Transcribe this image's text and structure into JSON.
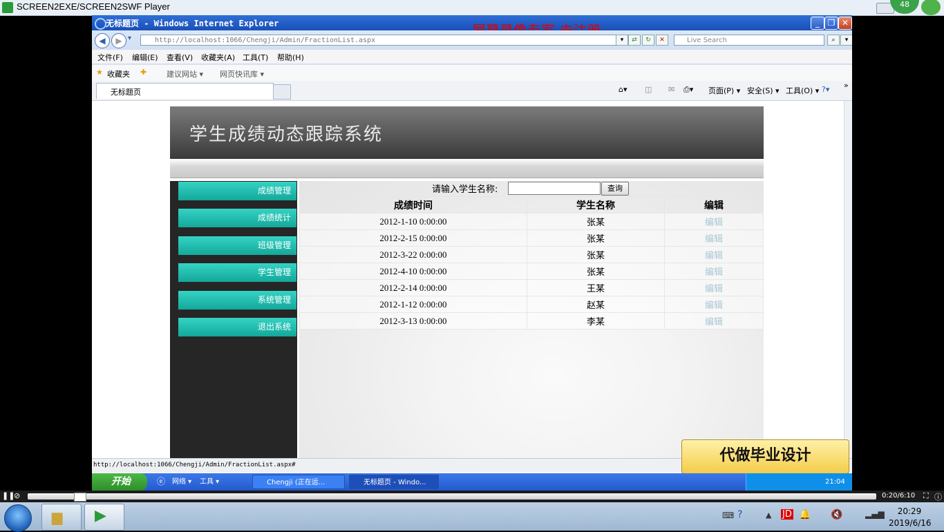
{
  "player": {
    "title": "SCREEN2EXE/SCREEN2SWF Player",
    "badge": "48",
    "timecode": "0:20/6:10"
  },
  "ie": {
    "window_title": "无标题页 - Windows Internet Explorer",
    "watermark": "屏幕录像专家 未注册",
    "address": "http://localhost:1066/Chengji/Admin/FractionList.aspx",
    "search_placeholder": "Live Search",
    "menu": [
      "文件(F)",
      "编辑(E)",
      "查看(V)",
      "收藏夹(A)",
      "工具(T)",
      "帮助(H)"
    ],
    "favorites": {
      "label": "收藏夹",
      "suggested": "建议网站 ▾",
      "slices": "网页快讯库 ▾"
    },
    "tab_title": "无标题页",
    "cmdbar": {
      "page": "页面(P) ▾",
      "safety": "安全(S) ▾",
      "tools": "工具(O) ▾"
    },
    "status_url": "http://localhost:1066/Chengji/Admin/FractionList.aspx#"
  },
  "app": {
    "banner_title": "学生成绩动态跟踪系统",
    "sidebar": [
      {
        "label": "成绩管理"
      },
      {
        "label": "成绩统计"
      },
      {
        "label": "班级管理"
      },
      {
        "label": "学生管理"
      },
      {
        "label": "系统管理"
      },
      {
        "label": "退出系统"
      }
    ],
    "search_label": "请输入学生名称:",
    "search_value": "",
    "search_button": "查询",
    "columns": [
      "成绩时间",
      "学生名称",
      "编辑"
    ],
    "rows": [
      {
        "time": "2012-1-10 0:00:00",
        "name": "张某",
        "action": "编辑"
      },
      {
        "time": "2012-2-15 0:00:00",
        "name": "张某",
        "action": "编辑"
      },
      {
        "time": "2012-3-22 0:00:00",
        "name": "张某",
        "action": "编辑"
      },
      {
        "time": "2012-4-10 0:00:00",
        "name": "张某",
        "action": "编辑"
      },
      {
        "time": "2012-2-14 0:00:00",
        "name": "王某",
        "action": "编辑"
      },
      {
        "time": "2012-1-12 0:00:00",
        "name": "赵某",
        "action": "编辑"
      },
      {
        "time": "2012-3-13 0:00:00",
        "name": "李某",
        "action": "编辑"
      }
    ]
  },
  "ad_text": "代做毕业设计",
  "xp_taskbar": {
    "start": "开始",
    "net": "网络 ▾",
    "tools": "工具 ▾",
    "task1": "Chengji (正在运...",
    "task2": "无标题页 - Windo...",
    "time": "21:04"
  },
  "win7_clock": {
    "time": "20:29",
    "date": "2019/6/16"
  },
  "colors": {
    "sidebar_item": "#1fb8aa",
    "banner": "#4a4a4a",
    "edit_link": "#a9c7d4",
    "watermark": "#e00000"
  }
}
